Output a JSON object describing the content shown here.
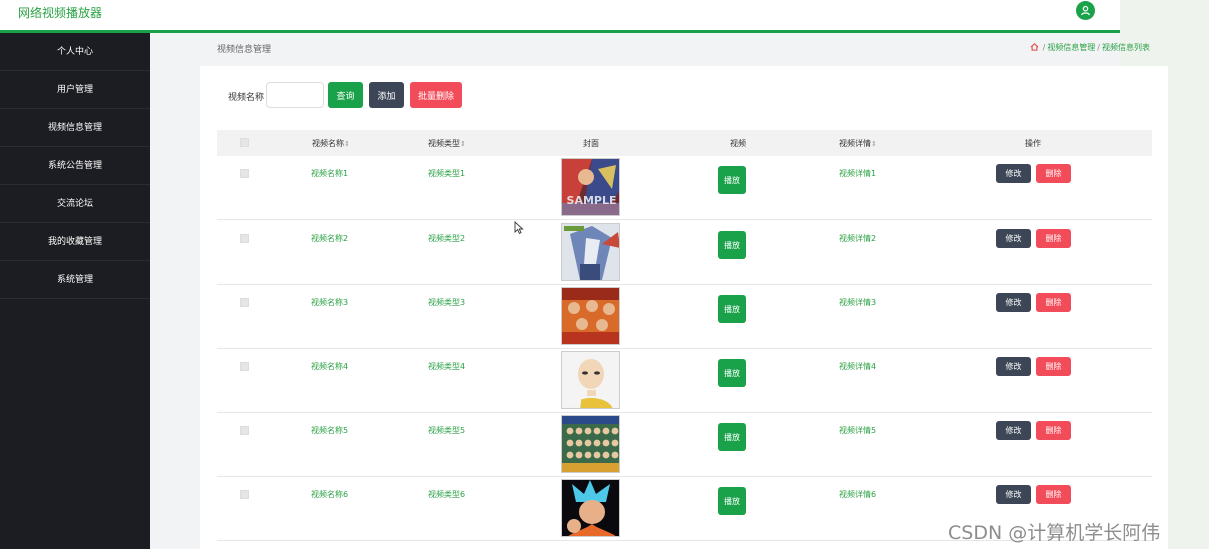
{
  "app": {
    "title": "网络视频播放器"
  },
  "colors": {
    "accent": "#19a24a",
    "danger": "#f24b59",
    "dark_button": "#3c4657",
    "sidebar_bg": "#1c1d22"
  },
  "sidebar": {
    "items": [
      {
        "label": "个人中心"
      },
      {
        "label": "用户管理"
      },
      {
        "label": "视频信息管理"
      },
      {
        "label": "系统公告管理"
      },
      {
        "label": "交流论坛"
      },
      {
        "label": "我的收藏管理"
      },
      {
        "label": "系统管理"
      }
    ]
  },
  "page": {
    "title": "视频信息管理",
    "breadcrumb": [
      "视频信息管理",
      "视频信息列表"
    ]
  },
  "search": {
    "label": "视频名称",
    "value": "",
    "placeholder": "",
    "query_label": "查询",
    "add_label": "添加",
    "batch_delete_label": "批量删除"
  },
  "table": {
    "headers": {
      "name": "视频名称",
      "type": "视频类型",
      "cover": "封面",
      "video": "视频",
      "detail": "视频详情",
      "actions": "操作"
    },
    "sort_glyph": "⇕",
    "play_label": "播放",
    "edit_label": "修改",
    "delete_label": "删除",
    "rows": [
      {
        "name": "视频名称1",
        "type": "视频类型1",
        "detail": "视频详情1",
        "cover_text": "SAMPLE"
      },
      {
        "name": "视频名称2",
        "type": "视频类型2",
        "detail": "视频详情2"
      },
      {
        "name": "视频名称3",
        "type": "视频类型3",
        "detail": "视频详情3"
      },
      {
        "name": "视频名称4",
        "type": "视频类型4",
        "detail": "视频详情4"
      },
      {
        "name": "视频名称5",
        "type": "视频类型5",
        "detail": "视频详情5"
      },
      {
        "name": "视频名称6",
        "type": "视频类型6",
        "detail": "视频详情6"
      }
    ]
  },
  "watermark": "CSDN @计算机学长阿伟"
}
